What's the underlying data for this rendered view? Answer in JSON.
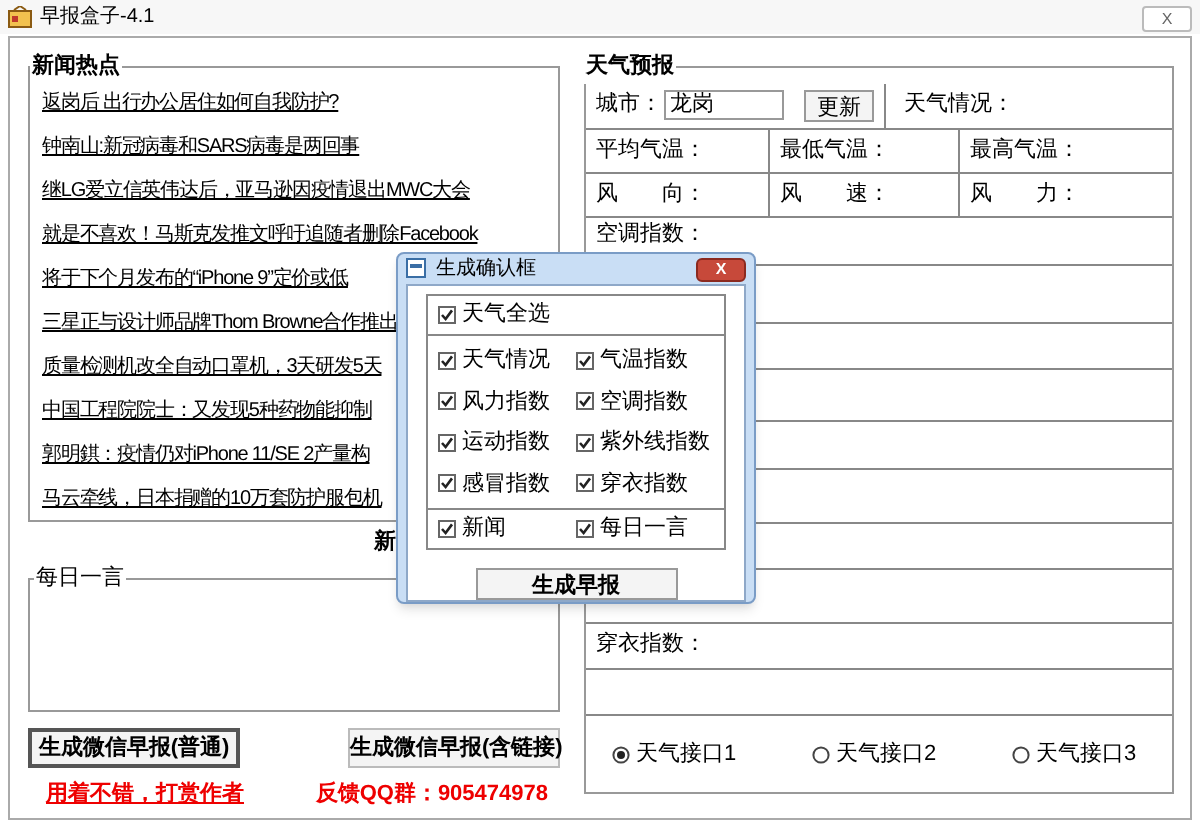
{
  "window": {
    "title": "早报盒子-4.1",
    "close": "X"
  },
  "news": {
    "title": "新闻热点",
    "items": [
      "返岗后 出行办公居住如何自我防护?",
      "钟南山:新冠病毒和SARS病毒是两回事",
      "继LG爱立信英伟达后，亚马逊因疫情退出MWC大会",
      "就是不喜欢！马斯克发推文呼吁追随者删除Facebook",
      "将于下个月发布的“iPhone 9”定价或低",
      "三星正与设计师品牌Thom Browne合作推出",
      "质量检测机改全自动口罩机，3天研发5天",
      "中国工程院院士：又发现5种药物能抑制",
      "郭明錤：疫情仍对iPhone 11/SE 2产量构",
      "马云牵线，日本捐赠的10万套防护服包机"
    ],
    "hidden_label": "新"
  },
  "daily_quote": {
    "title": "每日一言"
  },
  "buttons": [
    "生成微信早报(普通)",
    "生成微信早报(含链接)"
  ],
  "links": [
    "用着不错，打赏作者",
    "反馈QQ群：905474978"
  ],
  "weather": {
    "title": "天气预报",
    "city_label": "城市：",
    "city": "龙岗",
    "update_button": "更新",
    "condition_label": "天气情况：",
    "temps": [
      "平均气温：",
      "最低气温：",
      "最高气温："
    ],
    "wind": [
      "风　　向：",
      "风　　速：",
      "风　　力："
    ],
    "ac_label": "空调指数：",
    "clothing_label": "穿衣指数：",
    "sources": [
      {
        "label": "天气接口1",
        "selected": true
      },
      {
        "label": "天气接口2",
        "selected": false
      },
      {
        "label": "天气接口3",
        "selected": false
      }
    ]
  },
  "dialog": {
    "title": "生成确认框",
    "close": "X",
    "select_all": {
      "label": "天气全选",
      "checked": true
    },
    "options": [
      {
        "label": "天气情况",
        "checked": true
      },
      {
        "label": "气温指数",
        "checked": true
      },
      {
        "label": "风力指数",
        "checked": true
      },
      {
        "label": "空调指数",
        "checked": true
      },
      {
        "label": "运动指数",
        "checked": true
      },
      {
        "label": "紫外线指数",
        "checked": true
      },
      {
        "label": "感冒指数",
        "checked": true
      },
      {
        "label": "穿衣指数",
        "checked": true
      }
    ],
    "extras": [
      {
        "label": "新闻",
        "checked": true
      },
      {
        "label": "每日一言",
        "checked": true
      }
    ],
    "button": "生成早报"
  }
}
